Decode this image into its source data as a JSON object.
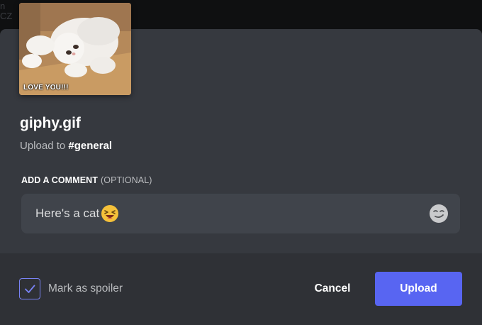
{
  "background": {
    "fragment_line1": "n",
    "fragment_line2": "CZ"
  },
  "attachment": {
    "thumbnail_caption": "LOVE YOU!!!",
    "filename": "giphy.gif",
    "upload_prefix": "Upload to ",
    "channel": "#general"
  },
  "comment": {
    "label": "ADD A COMMENT",
    "label_optional": "(OPTIONAL)",
    "value": "Here's a cat",
    "inline_emoji": "laughing-face",
    "emoji_button_icon": "smirking-face-icon"
  },
  "footer": {
    "spoiler_label": "Mark as spoiler",
    "spoiler_checked": true,
    "cancel_label": "Cancel",
    "upload_label": "Upload"
  },
  "colors": {
    "modal_bg": "#36393f",
    "footer_bg": "#2f3136",
    "input_bg": "#40444b",
    "accent": "#5865f2",
    "checkbox_border": "#7983f5"
  }
}
